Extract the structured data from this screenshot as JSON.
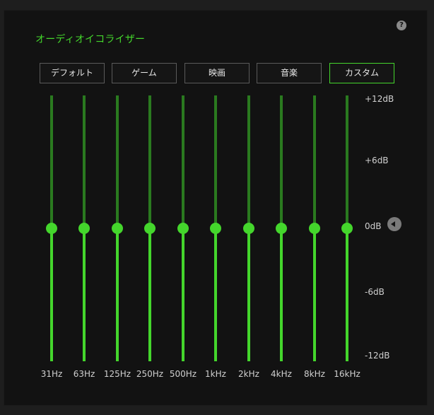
{
  "title": "オーディオイコライザー",
  "presets": [
    {
      "label": "デフォルト",
      "active": false
    },
    {
      "label": "ゲーム",
      "active": false
    },
    {
      "label": "映画",
      "active": false
    },
    {
      "label": "音楽",
      "active": false
    },
    {
      "label": "カスタム",
      "active": true
    }
  ],
  "scale": {
    "max_label": "+12dB",
    "mid_high_label": "+6dB",
    "zero_label": "0dB",
    "mid_low_label": "-6dB",
    "min_label": "-12dB",
    "min": -12,
    "max": 12
  },
  "bands": [
    {
      "label": "31Hz",
      "gain": 0
    },
    {
      "label": "63Hz",
      "gain": 0
    },
    {
      "label": "125Hz",
      "gain": 0
    },
    {
      "label": "250Hz",
      "gain": 0
    },
    {
      "label": "500Hz",
      "gain": 0
    },
    {
      "label": "1kHz",
      "gain": 0
    },
    {
      "label": "2kHz",
      "gain": 0
    },
    {
      "label": "4kHz",
      "gain": 0
    },
    {
      "label": "8kHz",
      "gain": 0
    },
    {
      "label": "16kHz",
      "gain": 0
    }
  ],
  "colors": {
    "accent": "#44d62c",
    "track_dim": "#2a7a1f"
  },
  "icons": {
    "help": "help-icon",
    "reset": "reset-arrow-icon"
  }
}
